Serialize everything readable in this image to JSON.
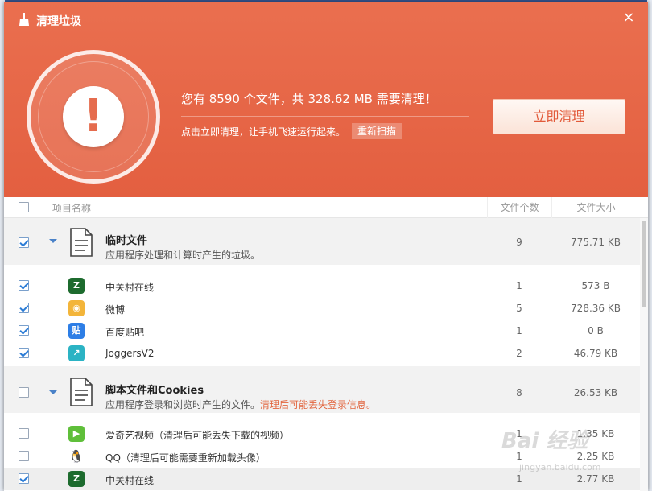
{
  "window": {
    "title": "清理垃圾",
    "close_label": "×"
  },
  "header": {
    "summary": "您有 8590 个文件，共 328.62 MB 需要清理！",
    "subline": "点击立即清理，让手机飞速运行起来。",
    "rescan_label": "重新扫描",
    "clean_label": "立即清理",
    "alert_mark": "!"
  },
  "columns": {
    "name": "项目名称",
    "count": "文件个数",
    "size": "文件大小"
  },
  "groups": [
    {
      "title": "临时文件",
      "desc": "应用程序处理和计算时产生的垃圾。",
      "warn": "",
      "count": "9",
      "size": "775.71 KB",
      "checked": true,
      "items": [
        {
          "label": "中关村在线",
          "count": "1",
          "size": "573 B",
          "checked": true,
          "icon": "zol-icon",
          "color": "#2c7a3a"
        },
        {
          "label": "微博",
          "count": "5",
          "size": "728.36 KB",
          "checked": true,
          "icon": "weibo-icon",
          "color": "#e8a33a"
        },
        {
          "label": "百度贴吧",
          "count": "1",
          "size": "0 B",
          "checked": true,
          "icon": "tieba-icon",
          "color": "#2d7ee6"
        },
        {
          "label": "JoggersV2",
          "count": "2",
          "size": "46.79 KB",
          "checked": true,
          "icon": "joggers-icon",
          "color": "#2bb3c4"
        }
      ]
    },
    {
      "title": "脚本文件和Cookies",
      "desc": "应用程序登录和浏览时产生的文件。",
      "warn": "清理后可能丢失登录信息。",
      "count": "8",
      "size": "26.53 KB",
      "checked": false,
      "items": [
        {
          "label": "爱奇艺视频（清理后可能丢失下载的视频）",
          "count": "1",
          "size": "1.35 KB",
          "checked": false,
          "icon": "iqiyi-icon",
          "color": "#5fbf3a"
        },
        {
          "label": "QQ（清理后可能需要重新加载头像）",
          "count": "1",
          "size": "2.25 KB",
          "checked": false,
          "icon": "qq-icon",
          "color": "#333333"
        },
        {
          "label": "中关村在线",
          "count": "1",
          "size": "2.77 KB",
          "checked": true,
          "icon": "zol-icon",
          "color": "#2c7a3a"
        }
      ]
    }
  ],
  "colors": {
    "header": "#e8694a",
    "accent": "#e25a3a",
    "check": "#2a7bd6"
  },
  "watermark": {
    "brand": "Bai 经验",
    "url": "jingyan.baidu.com"
  }
}
